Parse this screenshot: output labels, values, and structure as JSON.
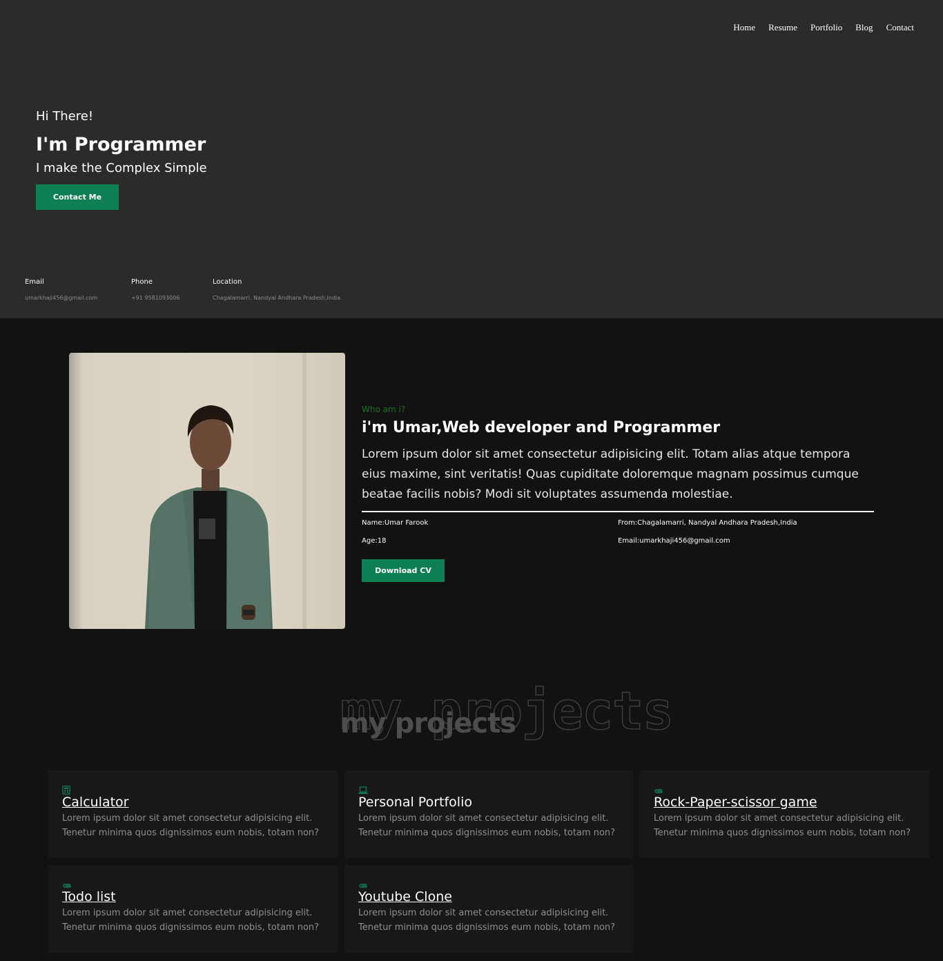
{
  "nav": [
    "Home",
    "Resume",
    "Portfolio",
    "Blog",
    "Contact"
  ],
  "hero": {
    "greeting": "Hi There!",
    "title": "I'm Programmer",
    "tagline": "I make the Complex Simple",
    "contact_button": "Contact Me"
  },
  "info": [
    {
      "label": "Email",
      "value": "umarkhaji456@gmail.com"
    },
    {
      "label": "Phone",
      "value": "+91 9581093006"
    },
    {
      "label": "Location",
      "value": "Chagalamarri, Nandyal Andhara Pradesh,India"
    }
  ],
  "about": {
    "kicker": "Who am i?",
    "heading": "i'm Umar,Web developer and Programmer",
    "body": "Lorem ipsum dolor sit amet consectetur adipisicing elit. Totam alias atque tempora eius maxime, sint veritatis! Quas cupiditate doloremque magnam possimus cumque beatae facilis nobis? Modi sit voluptates assumenda molestiae.",
    "facts": [
      "Name:Umar Farook",
      "From:Chagalamarri, Nandyal Andhara Pradesh,India",
      "Age:18",
      "Email:umarkhaji456@gmail.com"
    ],
    "cv_button": "Download CV"
  },
  "projects": {
    "heading": "my projects",
    "desc_line1": "Lorem ipsum dolor sit amet consectetur adipisicing elit.",
    "desc_line2": "Tenetur minima quos dignissimos eum nobis, totam non?",
    "items": [
      {
        "title": "Calculator",
        "icon": "calculator-icon"
      },
      {
        "title": "Personal Portfolio",
        "icon": "laptop-icon"
      },
      {
        "title": "Rock-Paper-scissor game",
        "icon": "paperclip-icon"
      },
      {
        "title": "Todo list",
        "icon": "paperclip-icon"
      },
      {
        "title": "Youtube Clone",
        "icon": "paperclip-icon"
      }
    ]
  },
  "colors": {
    "accent": "#0e7f52",
    "kicker": "#0f7a16",
    "hero_bg": "#2b2b2b",
    "page_bg": "#121212",
    "card_bg": "#181818"
  }
}
